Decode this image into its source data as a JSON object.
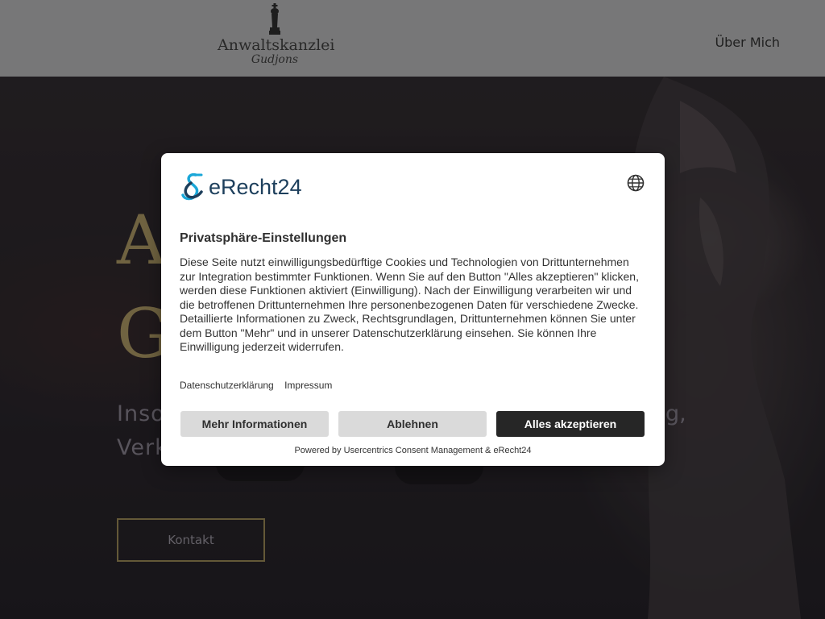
{
  "header": {
    "logo_name": "Anwaltskanzlei",
    "logo_sub": "Gudjons",
    "nav_label": "Über Mich"
  },
  "hero": {
    "title_line1": "A",
    "title_line2": "G",
    "text_line1": "Inso",
    "text_line2": "Verk",
    "text_line1_tail": "g,",
    "contact_label": "Kontakt"
  },
  "consent": {
    "brand": "eRecht24",
    "language_icon": "globe-icon",
    "title": "Privatsphäre-Einstellungen",
    "description": "Diese Seite nutzt einwilligungsbedürftige Cookies und Technologien von Drittunternehmen zur Integration bestimmter Funktionen. Wenn Sie auf den Button \"Alles akzeptieren\" klicken, werden diese Funktionen aktiviert (Einwilligung). Nach der Einwilligung verarbeiten wir und die betroffenen Drittunternehmen Ihre personenbezogenen Daten für verschiedene Zwecke. Detaillierte Informationen zu Zweck, Rechtsgrundlagen, Drittunternehmen können Sie unter dem Button \"Mehr\" und in unserer Datenschutzerklärung einsehen. Sie können Ihre Einwilligung jederzeit widerrufen.",
    "links": [
      "Datenschutzerklärung",
      "Impressum"
    ],
    "buttons": {
      "more": "Mehr Informationen",
      "deny": "Ablehnen",
      "accept": "Alles akzeptieren"
    },
    "powered_by": "Powered by Usercentrics Consent Management & eRecht24"
  },
  "colors": {
    "header_bg": "#a6a6a7",
    "accent_gold": "#9b8a5a",
    "brand_blue": "#1d3f5c",
    "brand_cyan": "#1aa7d8",
    "accept_bg": "#262626",
    "secondary_bg": "#dadada"
  }
}
